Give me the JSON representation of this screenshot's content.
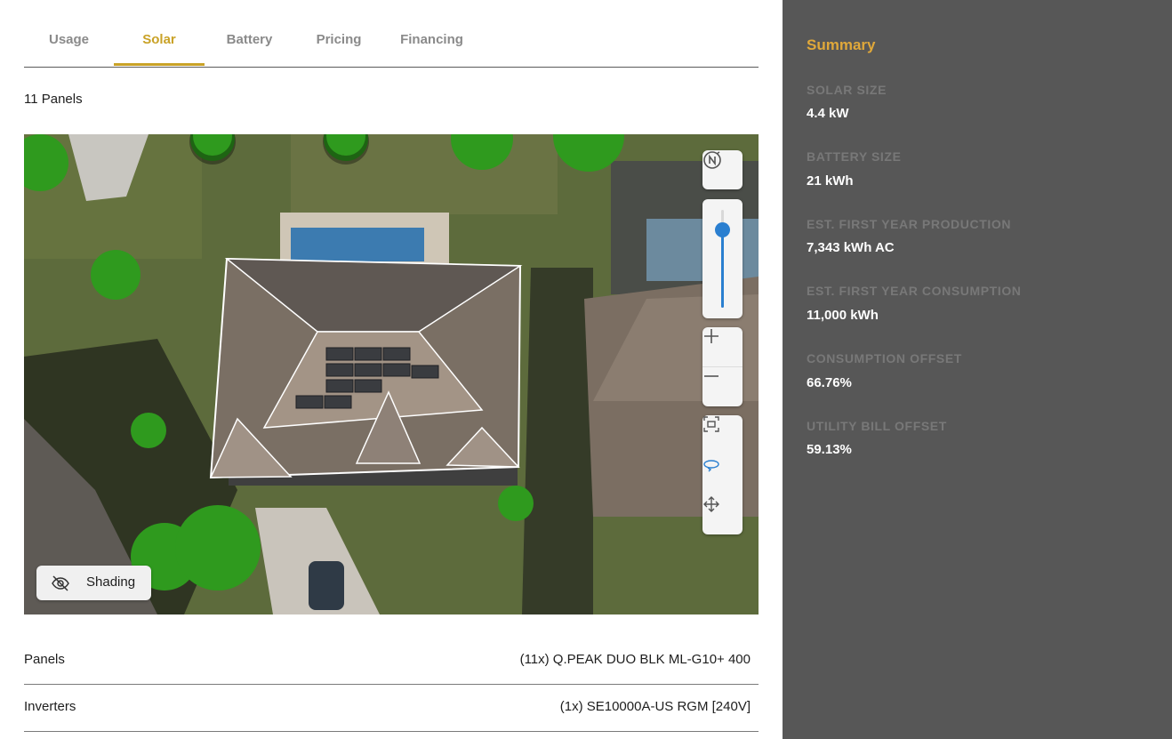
{
  "tabs": [
    {
      "label": "Usage"
    },
    {
      "label": "Solar"
    },
    {
      "label": "Battery"
    },
    {
      "label": "Pricing"
    },
    {
      "label": "Financing"
    }
  ],
  "active_tab": "Solar",
  "panel_count": "11 Panels",
  "map": {
    "shading_label": "Shading",
    "zoom_level": 0.55,
    "controls": [
      "compass-icon",
      "zoom-slider",
      "zoom-in-icon",
      "zoom-out-icon",
      "fit-view-icon",
      "rotate-icon",
      "pan-icon"
    ]
  },
  "equipment": [
    {
      "label": "Panels",
      "value": "(11x) Q.PEAK DUO BLK ML-G10+ 400"
    },
    {
      "label": "Inverters",
      "value": "(1x) SE10000A-US RGM [240V]"
    }
  ],
  "summary": {
    "title": "Summary",
    "stats": [
      {
        "label": "SOLAR SIZE",
        "value": "4.4 kW"
      },
      {
        "label": "BATTERY SIZE",
        "value": "21 kWh"
      },
      {
        "label": "EST. FIRST YEAR PRODUCTION",
        "value": "7,343 kWh AC"
      },
      {
        "label": "EST. FIRST YEAR CONSUMPTION",
        "value": "11,000 kWh"
      },
      {
        "label": "CONSUMPTION OFFSET",
        "value": "66.76%"
      },
      {
        "label": "UTILITY BILL OFFSET",
        "value": "59.13%"
      }
    ]
  },
  "colors": {
    "accent": "#c9a227",
    "summary_title": "#e0a83a",
    "sidebar_bg": "#575757",
    "slider": "#2a7fd0"
  }
}
